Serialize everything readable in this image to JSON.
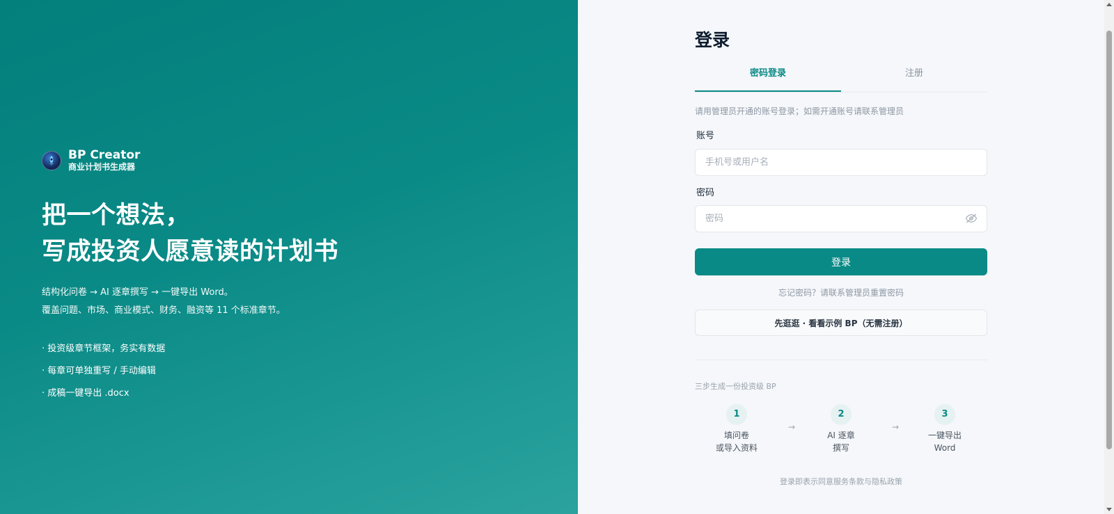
{
  "hero": {
    "brand_name": "BP Creator",
    "brand_subtitle": "商业计划书生成器",
    "headline_line1": "把一个想法，",
    "headline_line2": "写成投资人愿意读的计划书",
    "desc_line1": "结构化问卷 → AI 逐章撰写 → 一键导出 Word。",
    "desc_line2": "覆盖问题、市场、商业模式、财务、融资等 11 个标准章节。",
    "bullets": [
      "· 投资级章节框架，务实有数据",
      "· 每章可单独重写 / 手动编辑",
      "· 成稿一键导出 .docx"
    ]
  },
  "login": {
    "title": "登录",
    "tabs": [
      "密码登录",
      "注册"
    ],
    "active_tab": "密码登录",
    "hint": "请用管理员开通的账号登录；如需开通账号请联系管理员",
    "account_label": "账号",
    "account_placeholder": "手机号或用户名",
    "password_label": "密码",
    "password_placeholder": "密码",
    "submit_label": "登录",
    "forgot_text": "忘记密码？请联系管理员重置密码",
    "demo_label": "先逛逛 · 看看示例 BP（无需注册）"
  },
  "steps": {
    "title": "三步生成一份投资级 BP",
    "items": [
      {
        "num": "1",
        "line1": "填问卷",
        "line2": "或导入资料"
      },
      {
        "num": "2",
        "line1": "AI 逐章",
        "line2": "撰写"
      },
      {
        "num": "3",
        "line1": "一键导出",
        "line2": "Word"
      }
    ],
    "arrow": "→"
  },
  "footer_note": "登录即表示同意服务条款与隐私政策",
  "colors": {
    "accent": "#0a8a86",
    "hero_gradient_start": "#037f7c",
    "hero_gradient_end": "#2ba29e",
    "page_bg": "#f5f7fa"
  }
}
